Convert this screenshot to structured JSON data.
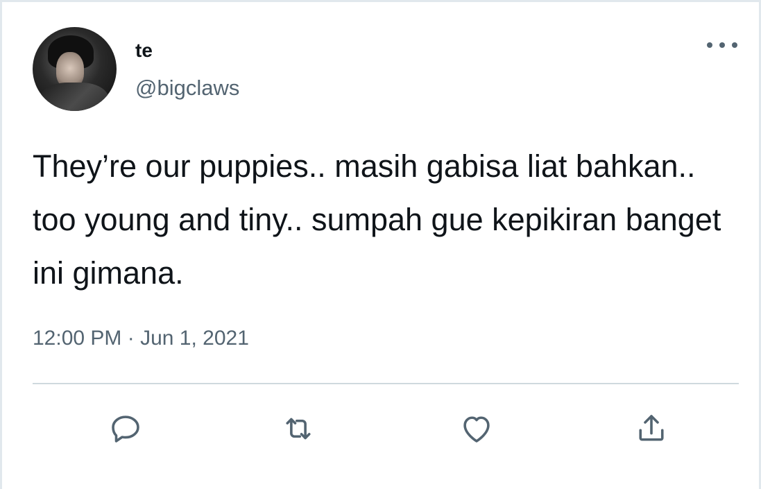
{
  "tweet": {
    "author_name": "te",
    "author_handle": "@bigclaws",
    "text": "They’re our puppies.. masih gabisa liat bahkan.. too young and tiny.. sumpah gue kepikiran banget ini gimana.",
    "time": "12:00 PM",
    "separator": " · ",
    "date": "Jun 1, 2021"
  },
  "icons": {
    "more": "more-horizontal-icon",
    "reply": "reply-icon",
    "retweet": "retweet-icon",
    "like": "heart-icon",
    "share": "share-icon"
  },
  "colors": {
    "text_primary": "#0f1419",
    "text_secondary": "#536471",
    "divider": "#cfd9de",
    "icon": "#536471"
  }
}
